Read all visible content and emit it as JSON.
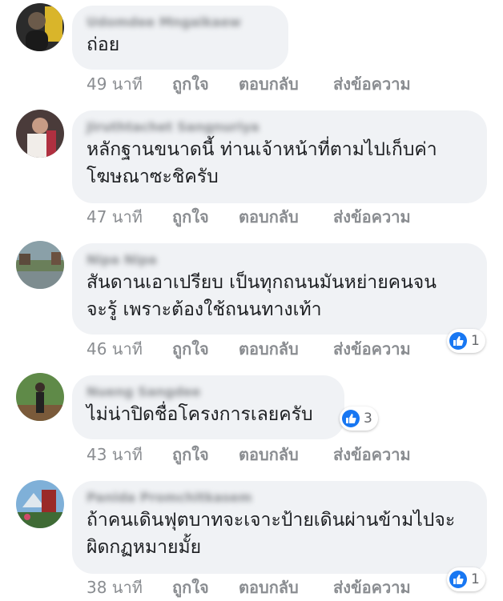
{
  "colors": {
    "bubble": "#f0f2f5",
    "meta_text": "#8a8d91",
    "body_text": "#1c1e21",
    "like_blue": "#1877f2"
  },
  "comments": [
    {
      "author": "Udomdee Mngaikaew",
      "text": "ถ่อย",
      "time": "49 นาที",
      "like": "ถูกใจ",
      "reply": "ตอบกลับ",
      "more": "ส่งข้อความ",
      "avatar_icon": "profile-photo",
      "reactions": null
    },
    {
      "author": "Jiruthtachet Sangnuriya",
      "text": "หลักฐานขนาดนี้ ท่านเจ้าหน้าที่ตามไปเก็บค่าโฆษณาซะชิครับ",
      "text_lines": [
        "หลักฐานขนาดนี้ ท่านเจ้าหน้าที่ตามไปเก็บค่า",
        "โฆษณาซะชิครับ"
      ],
      "time": "47 นาที",
      "like": "ถูกใจ",
      "reply": "ตอบกลับ",
      "more": "ส่งข้อความ",
      "avatar_icon": "profile-photo",
      "reactions": null
    },
    {
      "author": "Nipa Nipa",
      "text_lines": [
        "สันดานเอาเปรียบ เป็นทุกถนนมันหย่ายคนจน",
        "จะรู้ เพราะต้องใช้ถนนทางเท้า"
      ],
      "time": "46 นาที",
      "like": "ถูกใจ",
      "reply": "ตอบกลับ",
      "more": "ส่งข้อความ",
      "avatar_icon": "profile-photo",
      "reactions": {
        "icon": "thumbs-up-icon",
        "count": "1"
      }
    },
    {
      "author": "Nueng Sangdee",
      "text_lines": [
        "ไม่น่าปิดชื่อโครงการเลยครับ"
      ],
      "time": "43 นาที",
      "like": "ถูกใจ",
      "reply": "ตอบกลับ",
      "more": "ส่งข้อความ",
      "avatar_icon": "profile-photo",
      "reactions": {
        "icon": "thumbs-up-icon",
        "count": "3"
      }
    },
    {
      "author": "Panida Promchitkasem",
      "text_lines": [
        "ถ้าคนเดินฟุตบาทจะเจาะป้ายเดินผ่านข้ามไปจะ",
        "ผิดกฏหมายมั้ย"
      ],
      "time": "38 นาที",
      "like": "ถูกใจ",
      "reply": "ตอบกลับ",
      "more": "ส่งข้อความ",
      "avatar_icon": "profile-photo",
      "reactions": {
        "icon": "thumbs-up-icon",
        "count": "1"
      }
    }
  ]
}
